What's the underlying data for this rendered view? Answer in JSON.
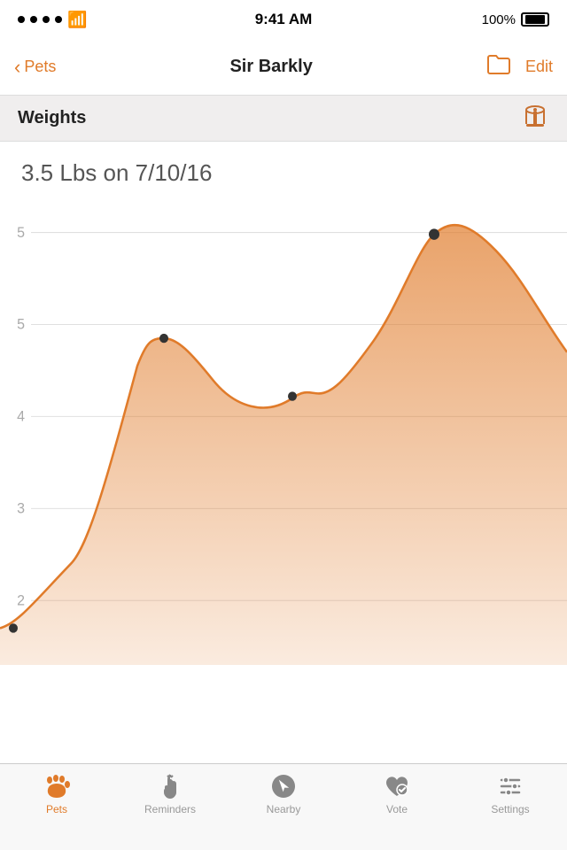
{
  "statusBar": {
    "time": "9:41 AM",
    "battery": "100%"
  },
  "navBar": {
    "backLabel": "Pets",
    "title": "Sir Barkly",
    "editLabel": "Edit"
  },
  "section": {
    "title": "Weights"
  },
  "weight": {
    "display": "3.5 Lbs on 7/10/16"
  },
  "chart": {
    "yLabels": [
      "5",
      "",
      "5",
      "",
      "4",
      "",
      "3",
      "",
      "2"
    ],
    "yLabelsFull": [
      "5",
      "5",
      "4",
      "3",
      "2"
    ]
  },
  "tabBar": {
    "items": [
      {
        "id": "pets",
        "label": "Pets",
        "active": true
      },
      {
        "id": "reminders",
        "label": "Reminders",
        "active": false
      },
      {
        "id": "nearby",
        "label": "Nearby",
        "active": false
      },
      {
        "id": "vote",
        "label": "Vote",
        "active": false
      },
      {
        "id": "settings",
        "label": "Settings",
        "active": false
      }
    ]
  }
}
